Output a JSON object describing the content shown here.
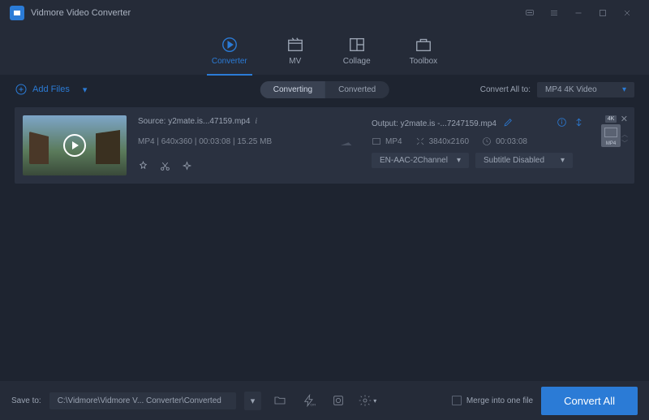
{
  "app": {
    "title": "Vidmore Video Converter"
  },
  "tabs": {
    "converter": "Converter",
    "mv": "MV",
    "collage": "Collage",
    "toolbox": "Toolbox"
  },
  "subbar": {
    "add_files": "Add Files",
    "converting": "Converting",
    "converted": "Converted",
    "convert_all_to": "Convert All to:",
    "format_selected": "MP4 4K Video"
  },
  "item": {
    "source_label": "Source: y2mate.is...47159.mp4",
    "meta": "MP4 | 640x360 | 00:03:08 | 15.25 MB",
    "output_label": "Output: y2mate.is -...7247159.mp4",
    "out_format": "MP4",
    "out_resolution": "3840x2160",
    "out_duration": "00:03:08",
    "audio_sel": "EN-AAC-2Channel",
    "subtitle_sel": "Subtitle Disabled",
    "fmt_badge": "4K",
    "fmt_txt": "MP4"
  },
  "footer": {
    "save_to": "Save to:",
    "path": "C:\\Vidmore\\Vidmore V... Converter\\Converted",
    "merge": "Merge into one file",
    "convert_all": "Convert All"
  }
}
